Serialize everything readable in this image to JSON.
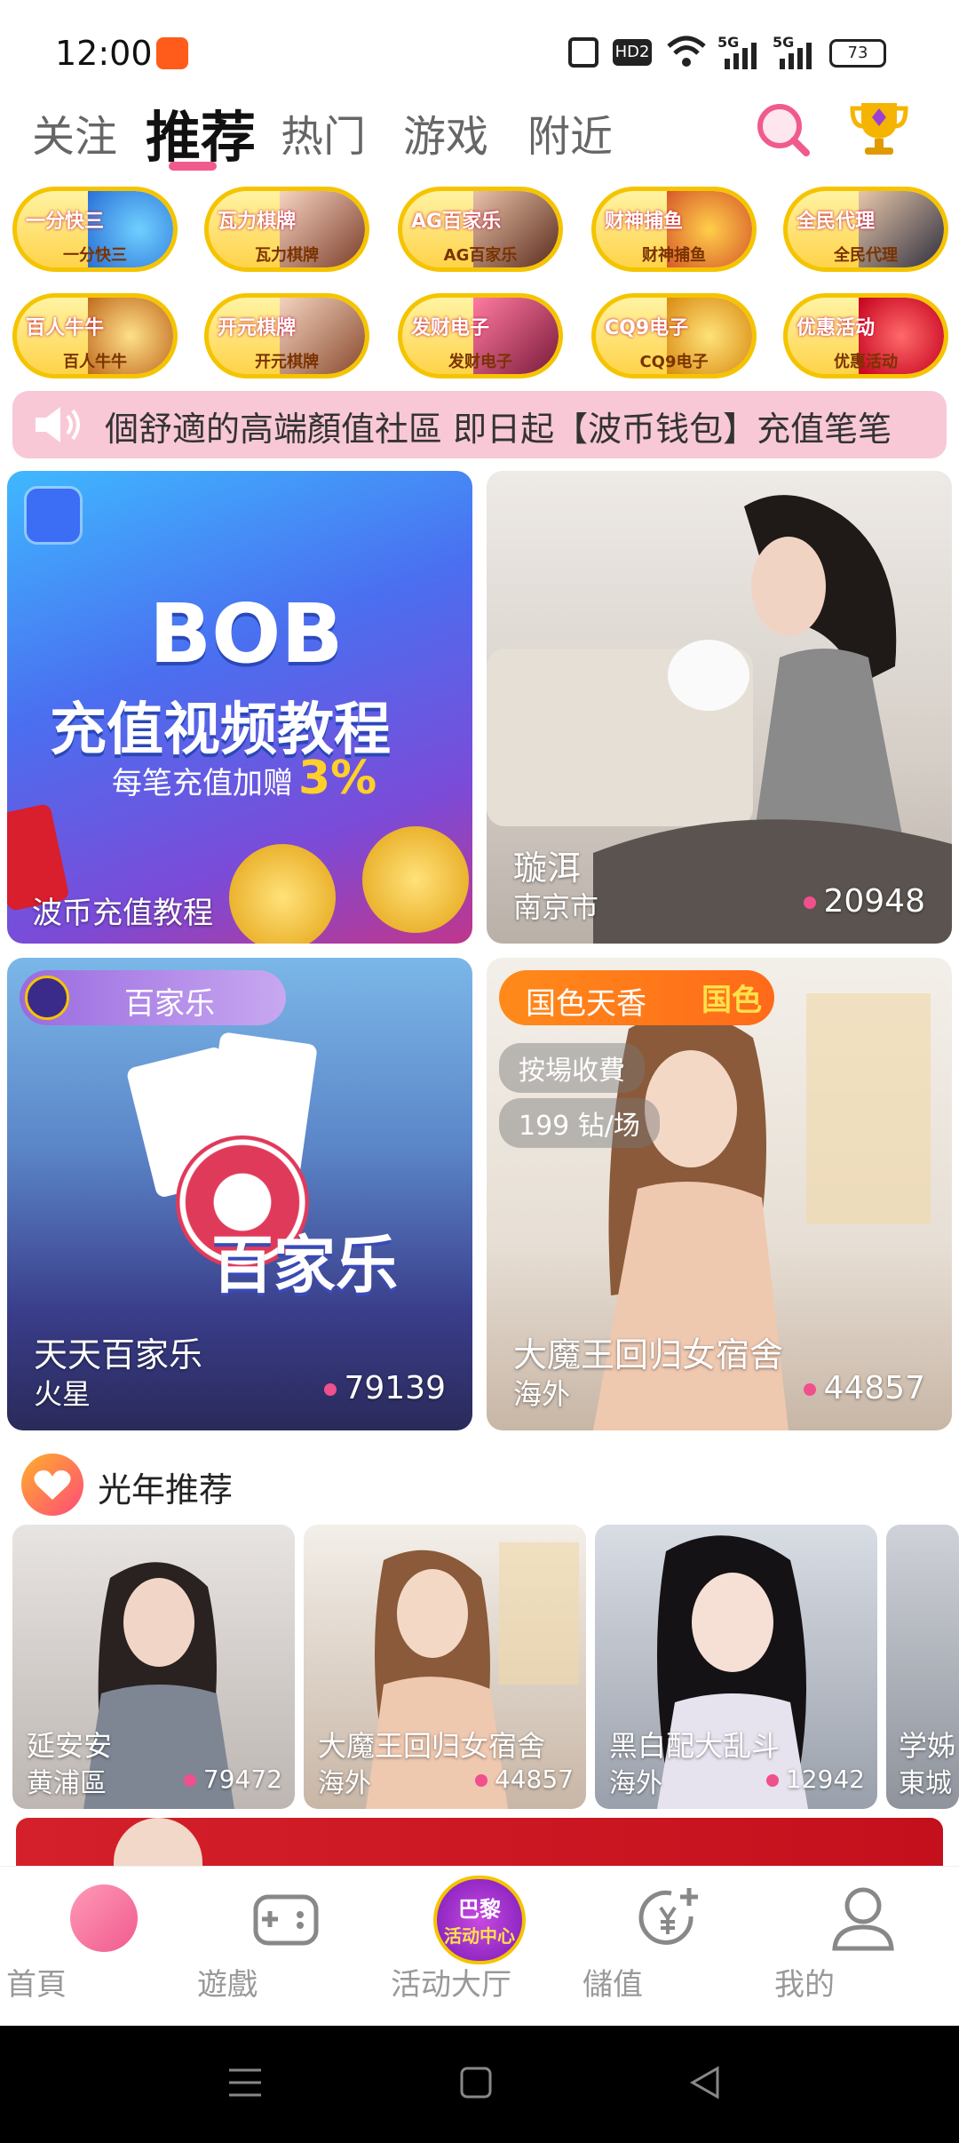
{
  "status": {
    "time": "12:00",
    "battery": "73",
    "network1": "5G",
    "network2": "5G",
    "hd": "HD2"
  },
  "tabs": [
    {
      "label": "关注"
    },
    {
      "label": "推荐"
    },
    {
      "label": "热门"
    },
    {
      "label": "游戏"
    },
    {
      "label": "附近"
    }
  ],
  "games": [
    {
      "big": "一分快三",
      "label": "一分快三"
    },
    {
      "big": "瓦力棋牌",
      "label": "瓦力棋牌"
    },
    {
      "big": "AG百家乐",
      "label": "AG百家乐"
    },
    {
      "big": "财神捕鱼",
      "label": "财神捕鱼"
    },
    {
      "big": "全民代理",
      "label": "全民代理"
    },
    {
      "big": "百人牛牛",
      "label": "百人牛牛"
    },
    {
      "big": "开元棋牌",
      "label": "开元棋牌"
    },
    {
      "big": "发财电子",
      "label": "发财电子"
    },
    {
      "big": "CQ9电子",
      "label": "CQ9电子"
    },
    {
      "big": "优惠活动",
      "label": "优惠活动"
    }
  ],
  "marquee": {
    "text": "個舒適的高端顏值社區 即日起【波币钱包】充值笔笔"
  },
  "cards": [
    {
      "banner_title": "BOB",
      "banner_sub": "充值视频教程",
      "banner_promo": "每笔充值加赠",
      "banner_percent": "3%",
      "title": "波币充值教程"
    },
    {
      "title": "璇洱",
      "location": "南京市",
      "count": "20948"
    },
    {
      "tag": "百家乐",
      "art": "百家乐",
      "title": "天天百家乐",
      "location": "火星",
      "count": "79139"
    },
    {
      "tag": "国色天香",
      "tag_logo": "国色",
      "pill1": "按場收費",
      "pill2": "199 钻/场",
      "title": "大魔王回归女宿舍",
      "location": "海外",
      "count": "44857"
    }
  ],
  "section": {
    "title": "光年推荐"
  },
  "recommend": [
    {
      "title": "延安安",
      "location": "黄浦區",
      "count": "79472"
    },
    {
      "title": "大魔王回归女宿舍",
      "location": "海外",
      "count": "44857"
    },
    {
      "title": "黑白配大乱斗",
      "location": "海外",
      "count": "12942"
    },
    {
      "title": "学姊",
      "location": "東城",
      "count": ""
    }
  ],
  "nav": [
    {
      "label": "首頁"
    },
    {
      "label": "遊戲"
    },
    {
      "label": "活动大厅",
      "badge_top": "巴黎",
      "badge_bottom": "活动中心"
    },
    {
      "label": "儲值"
    },
    {
      "label": "我的"
    }
  ],
  "colors": {
    "accent": "#f05a8d",
    "gold": "#f5c400",
    "marquee_bg": "#f8c8d6",
    "orange": "#ff7a1a"
  }
}
